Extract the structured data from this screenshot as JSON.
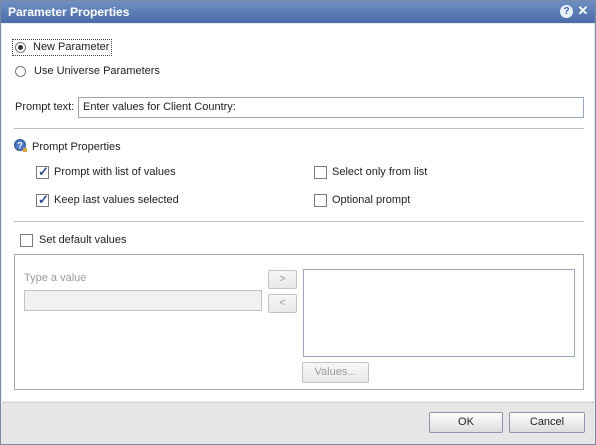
{
  "dialog": {
    "title": "Parameter Properties",
    "help_icon": "?",
    "close_icon": "✕"
  },
  "parameter_source": {
    "new_parameter_label": "New Parameter",
    "new_parameter_selected": true,
    "universe_parameters_label": "Use Universe Parameters",
    "universe_parameters_selected": false
  },
  "prompt_text": {
    "label": "Prompt text:",
    "value": "Enter values for Client Country:"
  },
  "prompt_properties": {
    "heading": "Prompt Properties",
    "icon": "help-key-icon",
    "options": [
      {
        "label": "Prompt with list of values",
        "checked": true
      },
      {
        "label": "Select only from list",
        "checked": false
      },
      {
        "label": "Keep last values selected",
        "checked": true
      },
      {
        "label": "Optional prompt",
        "checked": false
      }
    ]
  },
  "default_values": {
    "checkbox_label": "Set default values",
    "checked": false,
    "input_label": "Type a value",
    "input_value": "",
    "add_button": ">",
    "remove_button": "<",
    "values_button": "Values..."
  },
  "footer": {
    "ok_label": "OK",
    "cancel_label": "Cancel"
  }
}
